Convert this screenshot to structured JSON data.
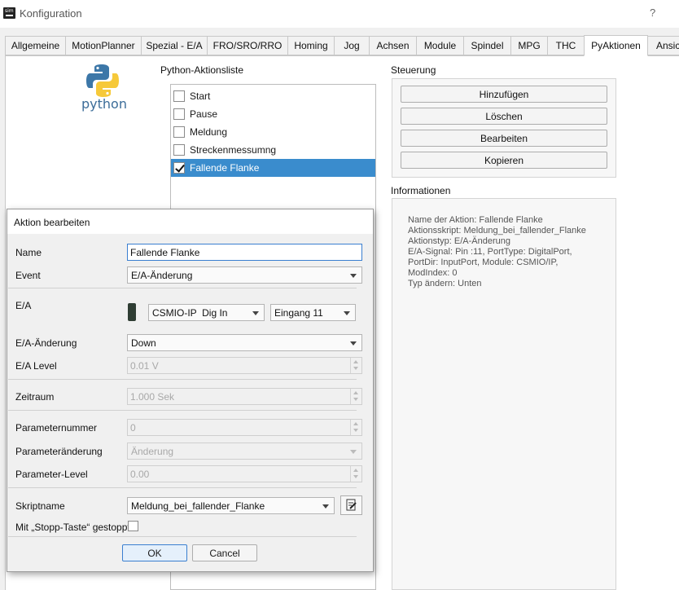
{
  "window": {
    "title": "Konfiguration",
    "help": "?"
  },
  "app_icon_text": "sim",
  "tabs": [
    "Allgemeine",
    "MotionPlanner",
    "Spezial - E/A",
    "FRO/SRO/RRO",
    "Homing",
    "Jog",
    "Achsen",
    "Module",
    "Spindel",
    "MPG",
    "THC",
    "PyAktionen",
    "Ansic"
  ],
  "active_tab": "PyAktionen",
  "logo_text": "python",
  "action_list": {
    "label": "Python-Aktionsliste",
    "items": [
      {
        "label": "Start",
        "checked": false
      },
      {
        "label": "Pause",
        "checked": false
      },
      {
        "label": "Meldung",
        "checked": false
      },
      {
        "label": "Streckenmessumng",
        "checked": false
      },
      {
        "label": "Fallende Flanke",
        "checked": true
      }
    ]
  },
  "control": {
    "label": "Steuerung",
    "buttons": [
      "Hinzufügen",
      "Löschen",
      "Bearbeiten",
      "Kopieren"
    ]
  },
  "info": {
    "label": "Informationen",
    "lines": [
      "Name der Aktion: Fallende Flanke",
      "Aktionsskript: Meldung_bei_fallender_Flanke",
      "Aktionstyp: E/A-Änderung",
      "E/A-Signal: Pin :11, PortType: DigitalPort,",
      "PortDir: InputPort, Module: CSMIO/IP,",
      "ModIndex: 0",
      "Typ ändern: Unten"
    ]
  },
  "dialog": {
    "title": "Aktion bearbeiten",
    "name_label": "Name",
    "name_value": "Fallende Flanke",
    "event_label": "Event",
    "event_value": "E/A-Änderung",
    "io_label": "E/A",
    "io_device": "CSMIO-IP  Dig In",
    "io_input": "Eingang 11",
    "io_change_label": "E/A-Änderung",
    "io_change_value": "Down",
    "io_level_label": "E/A Level",
    "io_level_value": "0.01 V",
    "period_label": "Zeitraum",
    "period_value": "1.000 Sek",
    "param_number_label": "Parameternummer",
    "param_number_value": "0",
    "param_change_label": "Parameteränderung",
    "param_change_value": "Änderung",
    "param_level_label": "Parameter-Level",
    "param_level_value": "0.00",
    "script_label": "Skriptname",
    "script_value": "Meldung_bei_fallender_Flanke",
    "stop_label": "Mit „Stopp-Taste“ gestoppt",
    "stop_checked": false,
    "ok": "OK",
    "cancel": "Cancel"
  }
}
